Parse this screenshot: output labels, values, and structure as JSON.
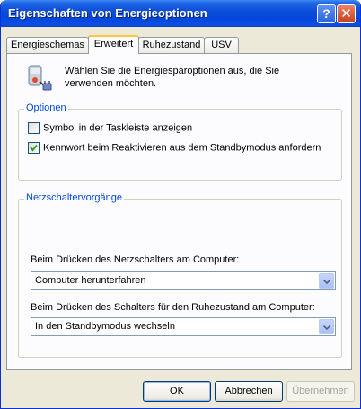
{
  "window": {
    "title": "Eigenschaften von Energieoptionen"
  },
  "titlebar": {
    "help_glyph": "?",
    "close_glyph": "✕"
  },
  "tabs": [
    {
      "label": "Energieschemas"
    },
    {
      "label": "Erweitert",
      "active": true
    },
    {
      "label": "Ruhezustand"
    },
    {
      "label": "USV"
    }
  ],
  "intro": {
    "text": "Wählen Sie die Energiesparoptionen aus, die Sie verwenden möchten.",
    "icon": "power-options-icon"
  },
  "options": {
    "title": "Optionen",
    "items": [
      {
        "label": "Symbol in der Taskleiste anzeigen",
        "checked": false
      },
      {
        "label": "Kennwort beim Reaktivieren aus dem Standbymodus anfordern",
        "checked": true
      }
    ]
  },
  "power_buttons": {
    "title": "Netzschaltervorgänge",
    "power_button_label": "Beim Drücken des Netzschalters am Computer:",
    "power_button_value": "Computer herunterfahren",
    "sleep_button_label": "Beim Drücken des Schalters für den Ruhezustand am Computer:",
    "sleep_button_value": "In den Standbymodus wechseln"
  },
  "buttons": {
    "ok": "OK",
    "cancel": "Abbrechen",
    "apply": "Übernehmen"
  },
  "colors": {
    "accent": "#0A4BD8",
    "group_label": "#0046D5",
    "tab_highlight": "#FFC83C"
  }
}
